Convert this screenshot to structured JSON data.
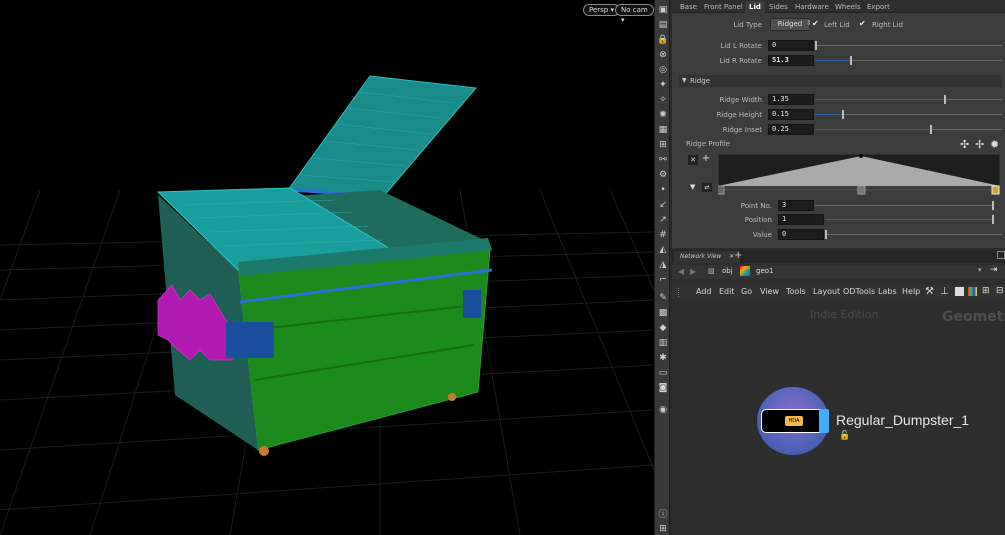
{
  "viewport": {
    "persp_label": "Persp",
    "cam_label": "No cam"
  },
  "params": {
    "tabs": [
      "Base",
      "Front Panel",
      "Lid",
      "Sides",
      "Hardware",
      "Wheels",
      "Export"
    ],
    "active_tab": "Lid",
    "lid_type_label": "Lid Type",
    "lid_type_value": "Ridged",
    "left_lid_label": "Left Lid",
    "right_lid_label": "Right Lid",
    "lid_l_rotate_label": "Lid L Rotate",
    "lid_l_rotate_value": "0",
    "lid_r_rotate_label": "Lid R Rotate",
    "lid_r_rotate_value": "51.3",
    "ridge_section": "Ridge",
    "ridge_width_label": "Ridge Width",
    "ridge_width_value": "1.35",
    "ridge_height_label": "Ridge Height",
    "ridge_height_value": "0.15",
    "ridge_inset_label": "Ridge Inset",
    "ridge_inset_value": "0.25",
    "ridge_profile_label": "Ridge Profile",
    "point_no_label": "Point No.",
    "point_no_value": "3",
    "position_label": "Position",
    "position_value": "1",
    "value_label": "Value",
    "value_value": "0"
  },
  "network": {
    "tab_label": "Network View",
    "path_obj": "obj",
    "path_geo": "geo1",
    "menu": [
      "Add",
      "Edit",
      "Go",
      "View",
      "Tools",
      "Layout",
      "ODTools",
      "Labs",
      "Help"
    ],
    "watermark_edition": "Indie Edition",
    "watermark_context": "Geometr",
    "node_name": "Regular_Dumpster_1",
    "node_badge": "HDA"
  }
}
